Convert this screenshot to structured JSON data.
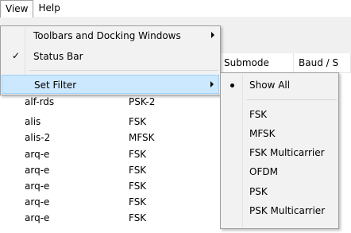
{
  "menubar": {
    "view_label": "View",
    "help_label": "Help"
  },
  "table": {
    "columns": {
      "submode": "Submode",
      "baud": "Baud / S"
    },
    "rows": [
      {
        "name": "alf-rds",
        "mode": "PSK-2"
      },
      {
        "name": "alis",
        "mode": "FSK"
      },
      {
        "name": "alis-2",
        "mode": "MFSK"
      },
      {
        "name": "arq-e",
        "mode": "FSK"
      },
      {
        "name": "arq-e",
        "mode": "FSK"
      },
      {
        "name": "arq-e",
        "mode": "FSK"
      },
      {
        "name": "arq-e",
        "mode": "FSK"
      },
      {
        "name": "arq-e",
        "mode": "FSK"
      }
    ]
  },
  "view_menu": {
    "items": [
      {
        "label": "Toolbars and Docking Windows",
        "checked": false,
        "submenu": true
      },
      {
        "label": "Status Bar",
        "checked": true,
        "submenu": false
      },
      {
        "label": "Set Filter",
        "checked": false,
        "submenu": true,
        "highlighted": true
      }
    ],
    "check_glyph": "✓"
  },
  "filter_submenu": {
    "selected": "Show All",
    "items": [
      "Show All",
      "FSK",
      "MFSK",
      "FSK Multicarrier",
      "OFDM",
      "PSK",
      "PSK Multicarrier"
    ]
  },
  "colors": {
    "highlight_bg": "#cce8ff",
    "highlight_border": "#99d1ff",
    "menu_bg": "#f2f2f2",
    "menu_border": "#9f9f9f"
  }
}
